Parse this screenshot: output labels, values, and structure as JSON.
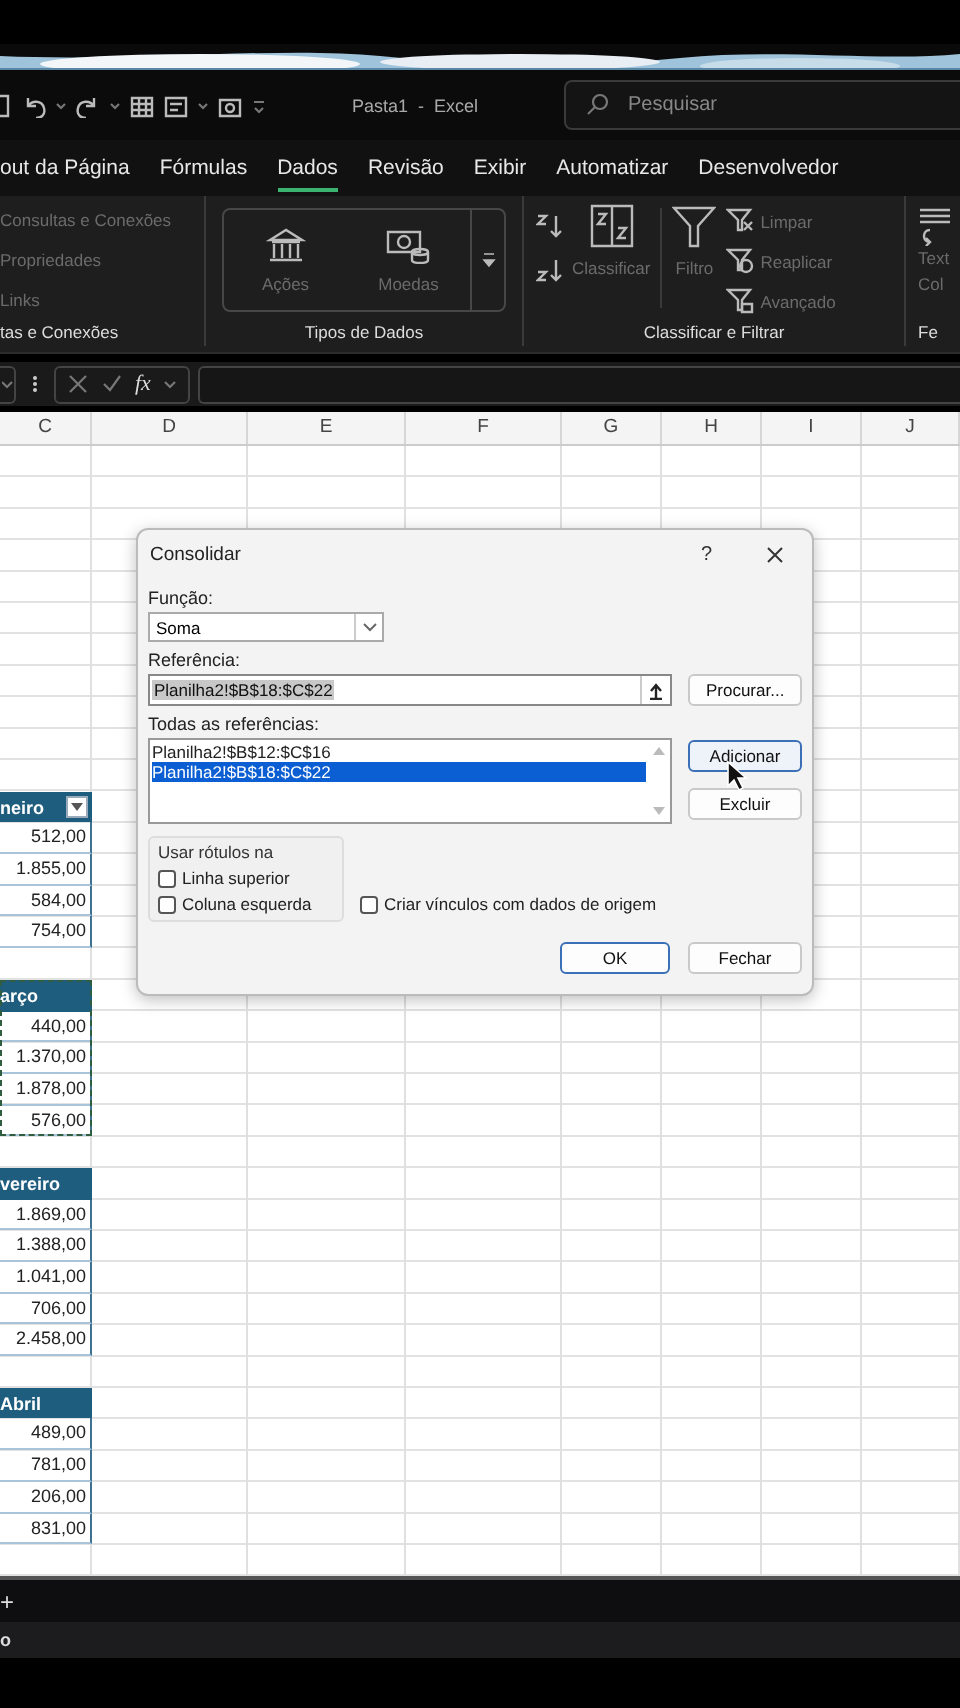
{
  "title_bar": {
    "document_title": "Pasta1  -  Excel",
    "search": {
      "placeholder": "Pesquisar"
    }
  },
  "ribbon_tabs": [
    {
      "label": "out da Página",
      "selected": false
    },
    {
      "label": "Fórmulas",
      "selected": false
    },
    {
      "label": "Dados",
      "selected": true
    },
    {
      "label": "Revisão",
      "selected": false
    },
    {
      "label": "Exibir",
      "selected": false
    },
    {
      "label": "Automatizar",
      "selected": false
    },
    {
      "label": "Desenvolvedor",
      "selected": false
    }
  ],
  "ribbon_groups": [
    {
      "kind": "queries",
      "label": "tas e Conexões",
      "items": [
        {
          "label": "Consultas e Conexões",
          "disabled": true
        },
        {
          "label": "Propriedades",
          "disabled": true
        },
        {
          "label": "Links",
          "disabled": true
        }
      ]
    },
    {
      "kind": "data_types",
      "label": "Tipos de Dados",
      "items": [
        {
          "kind": "stocks",
          "label": "Ações",
          "disabled": true
        },
        {
          "kind": "currencies",
          "label": "Moedas",
          "disabled": true
        }
      ]
    },
    {
      "kind": "sort_filter",
      "label": "Classificar e Filtrar",
      "items": [
        {
          "kind": "sort_az"
        },
        {
          "kind": "sort_za"
        },
        {
          "kind": "sort",
          "label": "Classificar",
          "disabled": true
        },
        {
          "kind": "filter",
          "label": "Filtro",
          "disabled": true
        },
        {
          "kind": "clear",
          "label": "Limpar",
          "disabled": true
        },
        {
          "kind": "reapply",
          "label": "Reaplicar",
          "disabled": true
        },
        {
          "kind": "advanced",
          "label": "Avançado",
          "disabled": true
        }
      ]
    },
    {
      "kind": "partial",
      "label": "Fe",
      "items": [
        {
          "label": "Text",
          "disabled": true
        },
        {
          "label": "Col",
          "disabled": true
        }
      ]
    }
  ],
  "formula_bar": {
    "function_label": "fx"
  },
  "columns": [
    "C",
    "D",
    "E",
    "F",
    "G",
    "H",
    "I",
    "J"
  ],
  "tables": [
    {
      "header": "neiro",
      "filter_button": true,
      "copy_marquee": false,
      "values": [
        "512,00",
        "1.855,00",
        "584,00",
        "754,00"
      ]
    },
    {
      "header": "arço",
      "filter_button": false,
      "copy_marquee": true,
      "values": [
        "440,00",
        "1.370,00",
        "1.878,00",
        "576,00"
      ]
    },
    {
      "header": "vereiro",
      "filter_button": false,
      "copy_marquee": false,
      "values": [
        "1.869,00",
        "1.388,00",
        "1.041,00",
        "706,00",
        "2.458,00"
      ]
    },
    {
      "header": "Abril",
      "filter_button": false,
      "copy_marquee": false,
      "values": [
        "489,00",
        "781,00",
        "206,00",
        "831,00"
      ]
    }
  ],
  "dialog": {
    "title": "Consolidar",
    "help": "?",
    "function": {
      "label": "Função:",
      "value": "Soma"
    },
    "reference": {
      "label": "Referência:",
      "value": "Planilha2!$B$18:$C$22"
    },
    "browse_button": "Procurar...",
    "all_references": {
      "label": "Todas as referências:",
      "items": [
        {
          "text": "Planilha2!$B$12:$C$16",
          "selected": false
        },
        {
          "text": "Planilha2!$B$18:$C$22",
          "selected": true
        }
      ]
    },
    "add_button": "Adicionar",
    "delete_button": "Excluir",
    "labels_group": {
      "title": "Usar rótulos na",
      "options": [
        {
          "label": "Linha superior",
          "checked": false
        },
        {
          "label": "Coluna esquerda",
          "checked": false
        }
      ]
    },
    "create_links": {
      "label": "Criar vínculos com dados de origem",
      "checked": false
    },
    "ok_button": "OK",
    "close_button": "Fechar"
  },
  "sheet_bar": {
    "add": "+"
  },
  "status_bar": {
    "text": "o"
  }
}
